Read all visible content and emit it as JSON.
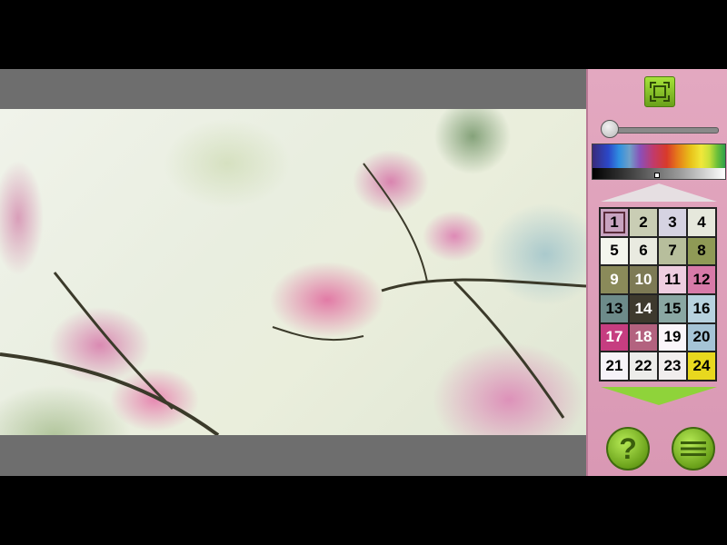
{
  "toolbar": {
    "zoom_fit_icon": "fit-to-screen-icon",
    "help_icon": "question-mark-icon",
    "help_label": "?",
    "menu_icon": "hamburger-menu-icon"
  },
  "brush_size": 0.0,
  "palette": {
    "selected_index": 0,
    "swatches": [
      {
        "label": "1",
        "bg": "#c8a3c0",
        "fg": "#000000"
      },
      {
        "label": "2",
        "bg": "#c9cdb4",
        "fg": "#000000"
      },
      {
        "label": "3",
        "bg": "#d6d3e2",
        "fg": "#000000"
      },
      {
        "label": "4",
        "bg": "#e6e8dc",
        "fg": "#000000"
      },
      {
        "label": "5",
        "bg": "#f4f6ee",
        "fg": "#000000"
      },
      {
        "label": "6",
        "bg": "#e9eae0",
        "fg": "#000000"
      },
      {
        "label": "7",
        "bg": "#b7be9c",
        "fg": "#000000"
      },
      {
        "label": "8",
        "bg": "#8f9a56",
        "fg": "#000000"
      },
      {
        "label": "9",
        "bg": "#8a8a5a",
        "fg": "#ffffff"
      },
      {
        "label": "10",
        "bg": "#7d7a55",
        "fg": "#ffffff"
      },
      {
        "label": "11",
        "bg": "#eecde0",
        "fg": "#000000"
      },
      {
        "label": "12",
        "bg": "#d77aa8",
        "fg": "#000000"
      },
      {
        "label": "13",
        "bg": "#6d8b8a",
        "fg": "#000000"
      },
      {
        "label": "14",
        "bg": "#3e3a2e",
        "fg": "#ffffff"
      },
      {
        "label": "15",
        "bg": "#8aa7a3",
        "fg": "#000000"
      },
      {
        "label": "16",
        "bg": "#b7d2df",
        "fg": "#000000"
      },
      {
        "label": "17",
        "bg": "#c63d80",
        "fg": "#ffffff"
      },
      {
        "label": "18",
        "bg": "#b3627f",
        "fg": "#ffffff"
      },
      {
        "label": "19",
        "bg": "#fbf6fa",
        "fg": "#000000"
      },
      {
        "label": "20",
        "bg": "#a5c4d6",
        "fg": "#000000"
      },
      {
        "label": "21",
        "bg": "#f6f3f8",
        "fg": "#000000"
      },
      {
        "label": "22",
        "bg": "#ececea",
        "fg": "#000000"
      },
      {
        "label": "23",
        "bg": "#f1eded",
        "fg": "#000000"
      },
      {
        "label": "24",
        "bg": "#e8d81e",
        "fg": "#000000"
      }
    ]
  }
}
